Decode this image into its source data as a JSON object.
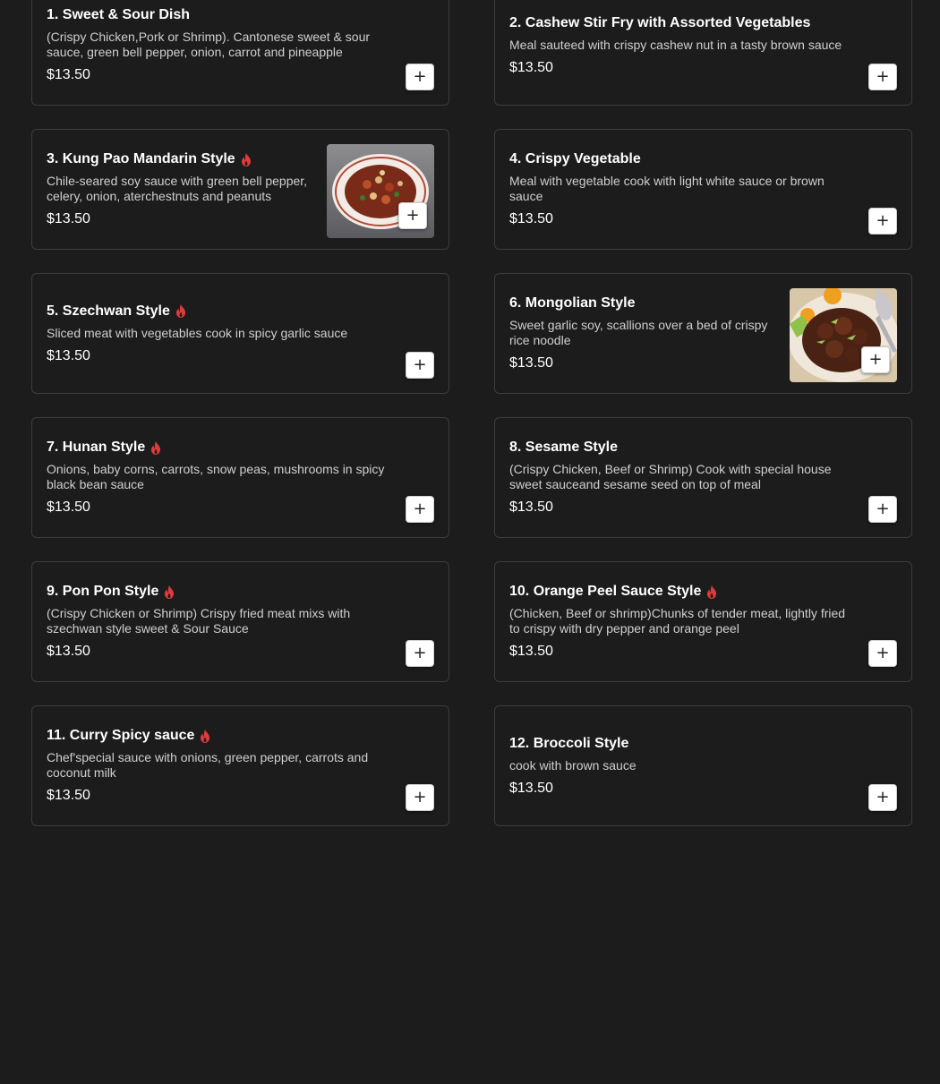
{
  "menu": {
    "items": [
      {
        "title": "1. Sweet & Sour Dish",
        "spicy": false,
        "desc": "(Crispy Chicken,Pork or Shrimp). Cantonese sweet & sour sauce, green bell pepper, onion, carrot and pineapple",
        "price": "$13.50",
        "add_label": "+"
      },
      {
        "title": "2. Cashew Stir Fry with Assorted Vegetables",
        "spicy": false,
        "desc": "Meal sauteed with crispy cashew nut in a tasty brown sauce",
        "price": "$13.50",
        "add_label": "+"
      },
      {
        "title": "3. Kung Pao Mandarin Style",
        "spicy": true,
        "desc": "Chile-seared soy sauce with green bell pepper, celery, onion, aterchestnuts and peanuts",
        "price": "$13.50",
        "add_label": "+",
        "image": "kung-pao-photo"
      },
      {
        "title": "4. Crispy Vegetable",
        "spicy": false,
        "desc": "Meal with vegetable cook with light white sauce or brown sauce",
        "price": "$13.50",
        "add_label": "+"
      },
      {
        "title": "5. Szechwan Style",
        "spicy": true,
        "desc": "Sliced meat with vegetables cook in spicy garlic sauce",
        "price": "$13.50",
        "add_label": "+"
      },
      {
        "title": "6. Mongolian Style",
        "spicy": false,
        "desc": "Sweet garlic soy, scallions over a bed of crispy rice noodle",
        "price": "$13.50",
        "add_label": "+",
        "image": "mongolian-photo"
      },
      {
        "title": "7. Hunan Style",
        "spicy": true,
        "desc": "Onions, baby corns, carrots, snow peas, mushrooms in spicy black bean sauce",
        "price": "$13.50",
        "add_label": "+"
      },
      {
        "title": "8. Sesame Style",
        "spicy": false,
        "desc": "(Crispy Chicken, Beef or Shrimp) Cook with special house sweet sauceand sesame seed on top of meal",
        "price": "$13.50",
        "add_label": "+"
      },
      {
        "title": "9. Pon Pon Style",
        "spicy": true,
        "desc": "(Crispy Chicken or Shrimp) Crispy fried meat mixs with szechwan style sweet & Sour Sauce",
        "price": "$13.50",
        "add_label": "+"
      },
      {
        "title": "10. Orange Peel Sauce Style",
        "spicy": true,
        "desc": "(Chicken, Beef or shrimp)Chunks of tender meat, lightly fried to crispy with dry pepper and orange peel",
        "price": "$13.50",
        "add_label": "+"
      },
      {
        "title": "11. Curry Spicy sauce",
        "spicy": true,
        "desc": "Chef'special sauce with onions, green pepper, carrots and coconut milk",
        "price": "$13.50",
        "add_label": "+"
      },
      {
        "title": "12. Broccoli Style",
        "spicy": false,
        "desc": "cook with brown sauce",
        "price": "$13.50",
        "add_label": "+"
      }
    ]
  },
  "colors": {
    "background": "#1c1c1c",
    "card_border": "#3c3c3c",
    "spicy_icon": "#e03b3b",
    "description": "#cfcfcf"
  }
}
